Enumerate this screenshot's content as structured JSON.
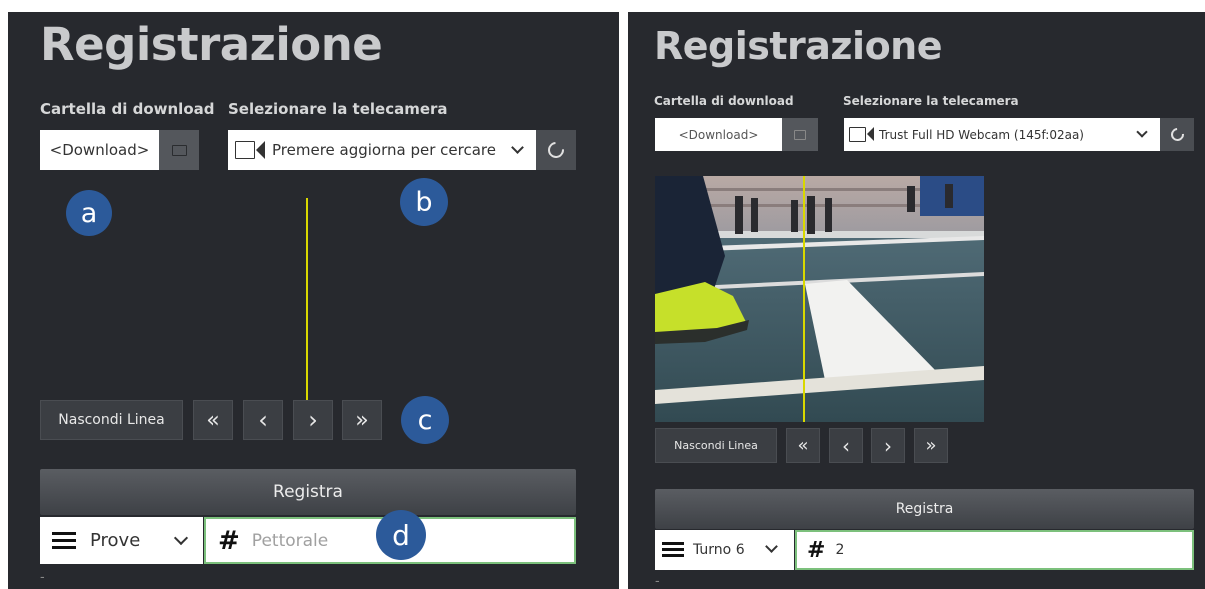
{
  "left": {
    "title": "Registrazione",
    "download_label": "Cartella di download",
    "camera_label": "Selezionare la telecamera",
    "download_value": "<Download>",
    "camera_value": "Premere aggiorna per cercare",
    "hide_line_label": "Nascondi Linea",
    "nav_buttons": [
      "«",
      "‹",
      "›",
      "»"
    ],
    "record_label": "Registra",
    "category_value": "Prove",
    "bib_placeholder": "Pettorale",
    "hash": "#",
    "badges": [
      "a",
      "b",
      "c",
      "d"
    ],
    "dash": "-"
  },
  "right": {
    "title": "Registrazione",
    "download_label": "Cartella di download",
    "camera_label": "Selezionare la telecamera",
    "download_value": "<Download>",
    "camera_value": "Trust Full HD Webcam (145f:02aa)",
    "hide_line_label": "Nascondi Linea",
    "nav_buttons": [
      "«",
      "‹",
      "›",
      "»"
    ],
    "record_label": "Registra",
    "category_value": "Turno 6",
    "bib_value": "2",
    "hash": "#",
    "dash": "-"
  },
  "colors": {
    "panel_bg": "#27292e",
    "finish_line": "#d9d800",
    "badge": "#2c5a9a",
    "input_border": "#7cc07c"
  },
  "icons": [
    "folder-icon",
    "camera-icon",
    "chevron-down-icon",
    "refresh-icon",
    "hamburger-icon",
    "hash-icon"
  ]
}
